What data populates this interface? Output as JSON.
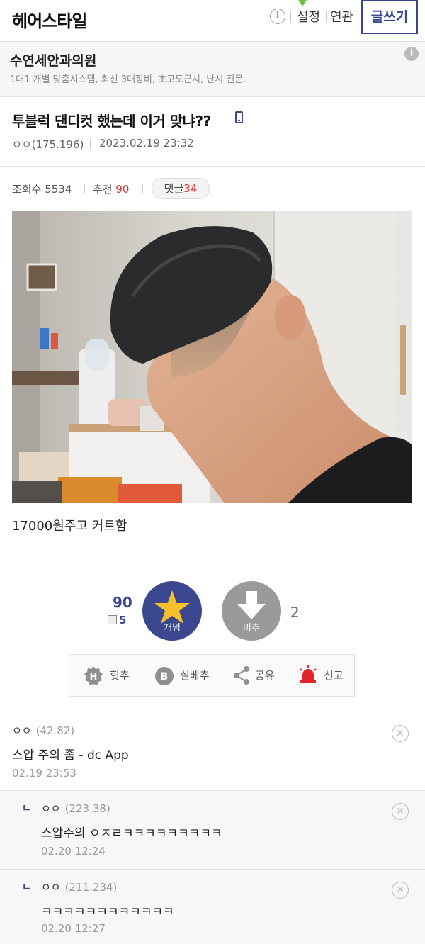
{
  "header": {
    "gallery_name": "헤어스타일",
    "info_icon": "i",
    "settings_label": "설정",
    "related_label": "연관",
    "write_label": "글쓰기"
  },
  "ad": {
    "title": "수연세안과의원",
    "description": "1대1 개별 맞춤시스템, 최신 3대장비, 초고도근시, 난시 전문.",
    "info_icon": "i"
  },
  "post": {
    "title": "투블럭 댄디컷 했는데 이거 맞냐??",
    "author": "ㅇㅇ(175.196)",
    "datetime": "2023.02.19 23:32",
    "views_label": "조회수",
    "views": "5534",
    "recommend_label": "추천",
    "recommend": "90",
    "comments_label": "댓글",
    "comments": "34",
    "body": "17000원주고 커트함"
  },
  "votes": {
    "up_count": "90",
    "fixed_count": "5",
    "up_label": "개념",
    "down_label": "비추",
    "down_count": "2"
  },
  "actions": {
    "hit_label": "힛추",
    "best_label": "실베추",
    "share_label": "공유",
    "report_label": "신고",
    "hit_icon_letter": "H",
    "best_icon_letter": "B"
  },
  "comments": [
    {
      "name": "ㅇㅇ",
      "ip": "(42.82)",
      "text": "스압 주의 좀 - dc App",
      "time": "02.19 23:53"
    },
    {
      "name": "ㅇㅇ",
      "ip": "(223.38)",
      "text": "스압주의 ㅇㅈㄹㅋㅋㅋㅋㅋㅋㅋㅋㅋ",
      "time": "02.20 12:24",
      "reply_mark": "ㄴ"
    },
    {
      "name": "ㅇㅇ",
      "ip": "(211.234)",
      "text": "ㅋㅋㅋㅋㅋㅋㅋㅋㅋㅋㅋㅋ",
      "time": "02.20 12:27",
      "reply_mark": "ㄴ"
    }
  ],
  "close_glyph": "✕"
}
